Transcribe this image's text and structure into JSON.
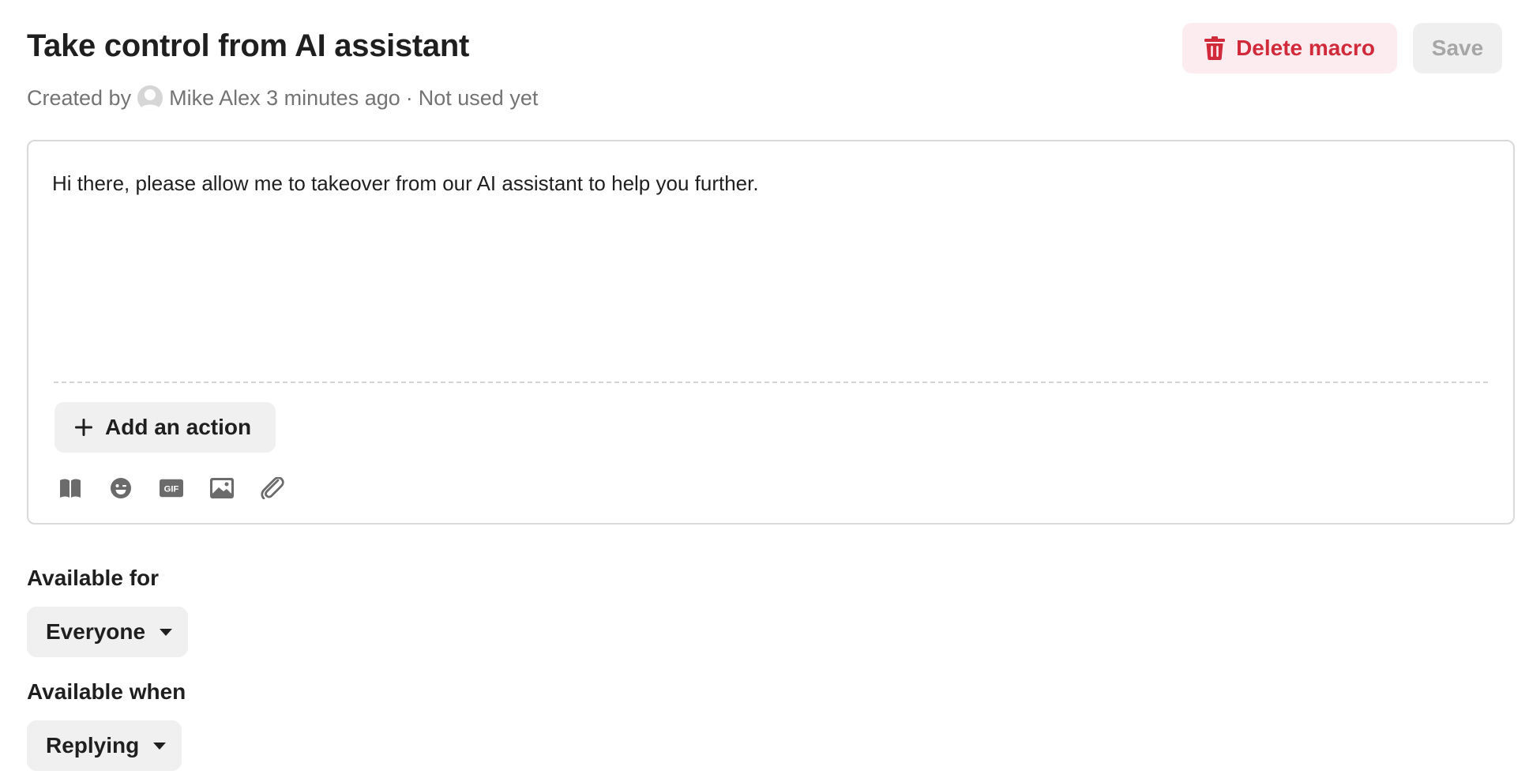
{
  "header": {
    "title": "Take control from AI assistant",
    "meta": {
      "created_by_label": "Created by",
      "author": "Mike Alex",
      "time": "3 minutes ago",
      "separator": "·",
      "usage": "Not used yet"
    },
    "delete_label": "Delete macro",
    "save_label": "Save"
  },
  "composer": {
    "message": "Hi there, please allow me to takeover from our AI assistant to help you further.",
    "add_action_label": "Add an action",
    "toolbar_icons": [
      "book-icon",
      "emoji-icon",
      "gif-icon",
      "image-icon",
      "paperclip-icon"
    ]
  },
  "availability": {
    "for_label": "Available for",
    "for_value": "Everyone",
    "when_label": "Available when",
    "when_value": "Replying"
  },
  "colors": {
    "danger": "#d12b3b",
    "danger_bg": "#fdecef",
    "neutral_bg": "#f0f0f0",
    "muted_text": "#737373"
  }
}
